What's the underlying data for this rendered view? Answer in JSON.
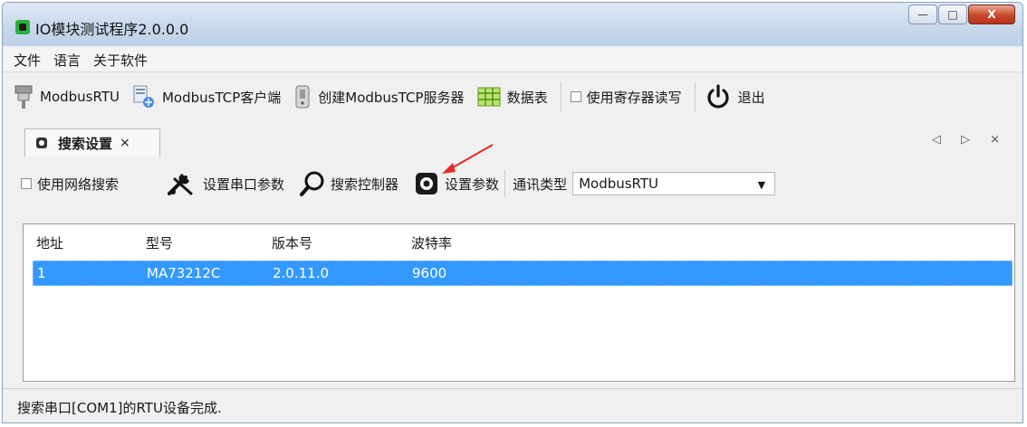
{
  "window": {
    "title": "IO模块测试程序2.0.0.0"
  },
  "title_buttons": {
    "minimize": "—",
    "maximize": "□",
    "close": "X"
  },
  "menu": [
    "文件",
    "语言",
    "关于软件"
  ],
  "toolbar": {
    "modbus_rtu": "ModbusRTU",
    "modbus_tcp_client": "ModbusTCP客户端",
    "create_tcp_server": "创建ModbusTCP服务器",
    "data_table": "数据表",
    "use_register_rw": "使用寄存器读写",
    "exit": "退出"
  },
  "tab": {
    "label": "搜索设置",
    "close": "×",
    "nav": "◁ ▷ ×"
  },
  "controls": {
    "network_search": "使用网络搜索",
    "serial_params": "设置串口参数",
    "search_controller": "搜索控制器",
    "set_params": "设置参数",
    "comm_type_label": "通讯类型",
    "comm_type_value": "ModbusRTU"
  },
  "table": {
    "columns": [
      "地址",
      "型号",
      "版本号",
      "波特率"
    ],
    "rows": [
      {
        "address": "1",
        "model": "MA73212C",
        "version": "2.0.11.0",
        "baud": "9600"
      }
    ]
  },
  "status": "搜索串口[COM1]的RTU设备完成.",
  "colors": {
    "selection": "#3399ff",
    "annotation_arrow": "#e52a2a"
  }
}
